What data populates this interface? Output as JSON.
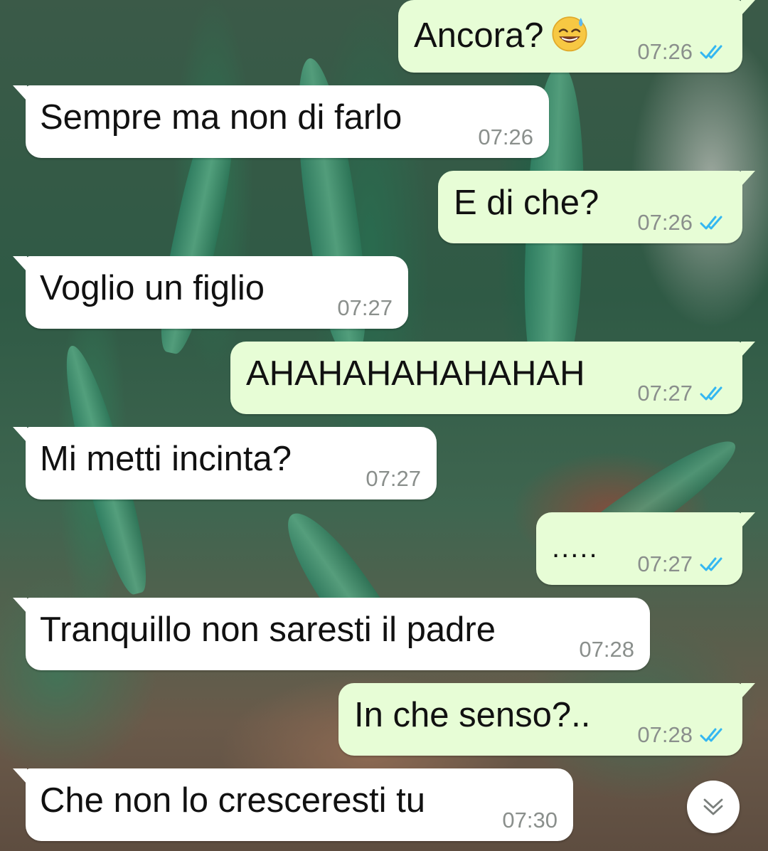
{
  "messages": [
    {
      "direction": "out",
      "text": "Ancora?",
      "emoji": "grinning-sweat-emoji",
      "time": "07:26",
      "status": "read"
    },
    {
      "direction": "in",
      "text": "Sempre ma non di farlo",
      "time": "07:26"
    },
    {
      "direction": "out",
      "text": "E di che?",
      "time": "07:26",
      "status": "read"
    },
    {
      "direction": "in",
      "text": "Voglio un figlio",
      "time": "07:27"
    },
    {
      "direction": "out",
      "text": "AHAHAHAHAHAHAH",
      "time": "07:27",
      "status": "read"
    },
    {
      "direction": "in",
      "text": "Mi metti incinta?",
      "time": "07:27"
    },
    {
      "direction": "out",
      "text": ".....",
      "time": "07:27",
      "status": "read"
    },
    {
      "direction": "in",
      "text": "Tranquillo non saresti il padre",
      "time": "07:28"
    },
    {
      "direction": "out",
      "text": "In che senso?..",
      "time": "07:28",
      "status": "read"
    },
    {
      "direction": "in",
      "text": "Che non lo cresceresti tu",
      "time": "07:30"
    }
  ],
  "colors": {
    "incoming_bubble": "#ffffff",
    "outgoing_bubble": "#e7fdd6",
    "read_ticks": "#34b7f1",
    "timestamp": "#8a8f8c"
  },
  "scroll_button": {
    "icon": "double-chevron-down-icon"
  }
}
